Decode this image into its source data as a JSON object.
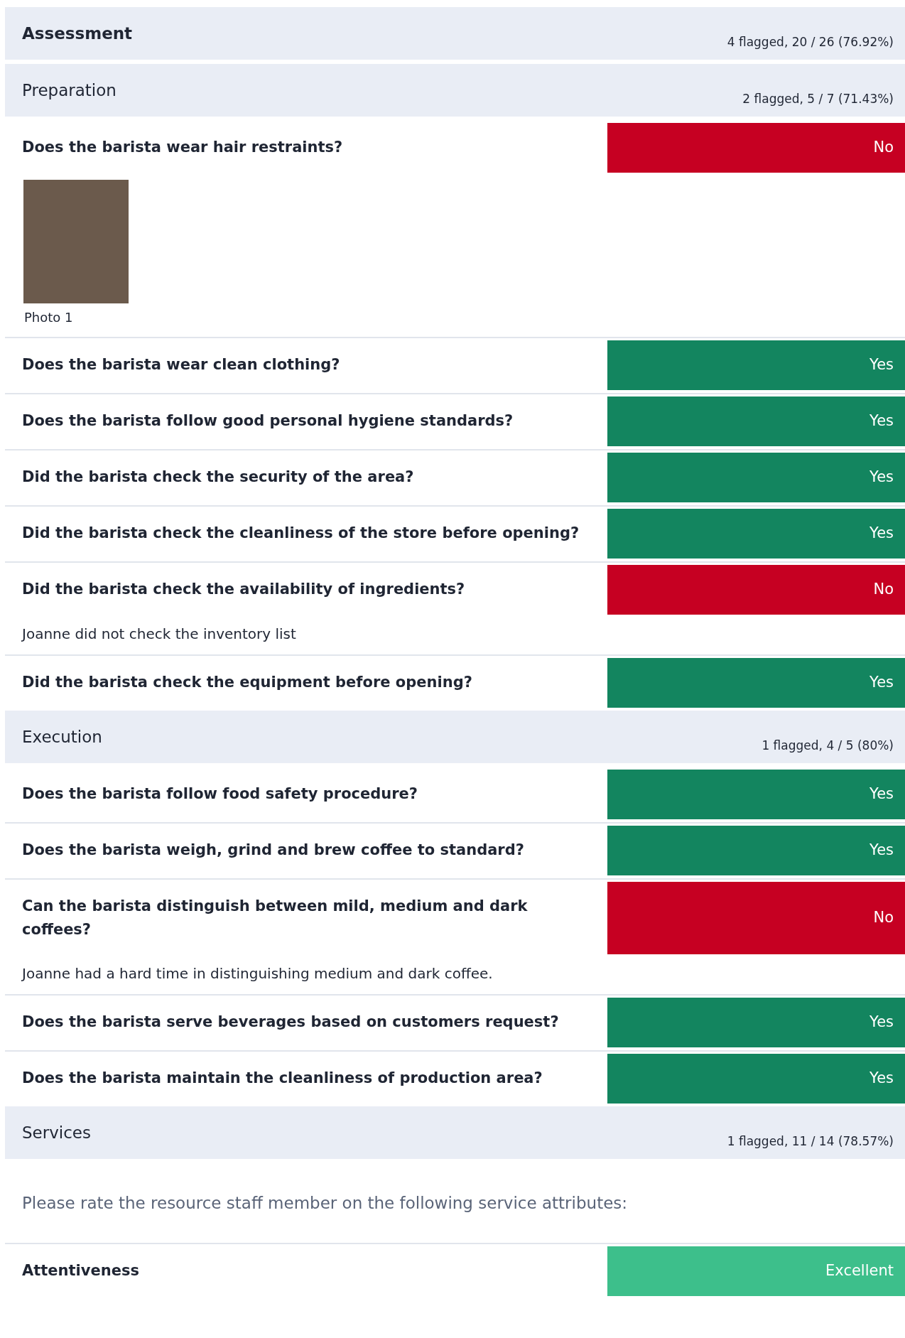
{
  "assessment": {
    "title": "Assessment",
    "stats": "4 flagged, 20 / 26 (76.92%)"
  },
  "sections": [
    {
      "title": "Preparation",
      "stats": "2 flagged, 5 / 7 (71.43%)",
      "items": [
        {
          "kind": "question",
          "question": "Does the barista wear hair restraints?",
          "answer": "No",
          "color": "#c60022",
          "photos": [
            {
              "caption": "Photo 1"
            }
          ]
        },
        {
          "kind": "question",
          "question": "Does the barista wear clean clothing?",
          "answer": "Yes",
          "color": "#13855f"
        },
        {
          "kind": "question",
          "question": "Does the barista follow good personal hygiene standards?",
          "answer": "Yes",
          "color": "#13855f"
        },
        {
          "kind": "question",
          "question": "Did the barista check the security of the area?",
          "answer": "Yes",
          "color": "#13855f"
        },
        {
          "kind": "question",
          "question": "Did the barista check the cleanliness of the store before opening?",
          "answer": "Yes",
          "color": "#13855f"
        },
        {
          "kind": "question",
          "question": "Did the barista check the availability of ingredients?",
          "answer": "No",
          "color": "#c60022",
          "note": "Joanne did not check the inventory list"
        },
        {
          "kind": "question",
          "question": "Did the barista check the equipment before opening?",
          "answer": "Yes",
          "color": "#13855f"
        }
      ]
    },
    {
      "title": "Execution",
      "stats": "1 flagged, 4 / 5 (80%)",
      "items": [
        {
          "kind": "question",
          "question": "Does the barista follow food safety procedure?",
          "answer": "Yes",
          "color": "#13855f"
        },
        {
          "kind": "question",
          "question": "Does the barista weigh, grind and brew coffee to standard?",
          "answer": "Yes",
          "color": "#13855f"
        },
        {
          "kind": "question",
          "question": "Can the barista distinguish between mild, medium and dark coffees?",
          "answer": "No",
          "color": "#c60022",
          "note": "Joanne had a hard time in distinguishing medium and dark coffee."
        },
        {
          "kind": "question",
          "question": "Does the barista serve beverages based on customers request?",
          "answer": "Yes",
          "color": "#13855f"
        },
        {
          "kind": "question",
          "question": "Does the barista maintain the cleanliness of production area?",
          "answer": "Yes",
          "color": "#13855f"
        }
      ]
    },
    {
      "title": "Services",
      "stats": "1 flagged, 11 / 14 (78.57%)",
      "items": [
        {
          "kind": "instruction",
          "text": "Please rate the resource  staff member on the following service attributes:"
        },
        {
          "kind": "question",
          "question": "Attentiveness",
          "answer": "Excellent",
          "color": "#3dbf8b"
        }
      ]
    }
  ]
}
